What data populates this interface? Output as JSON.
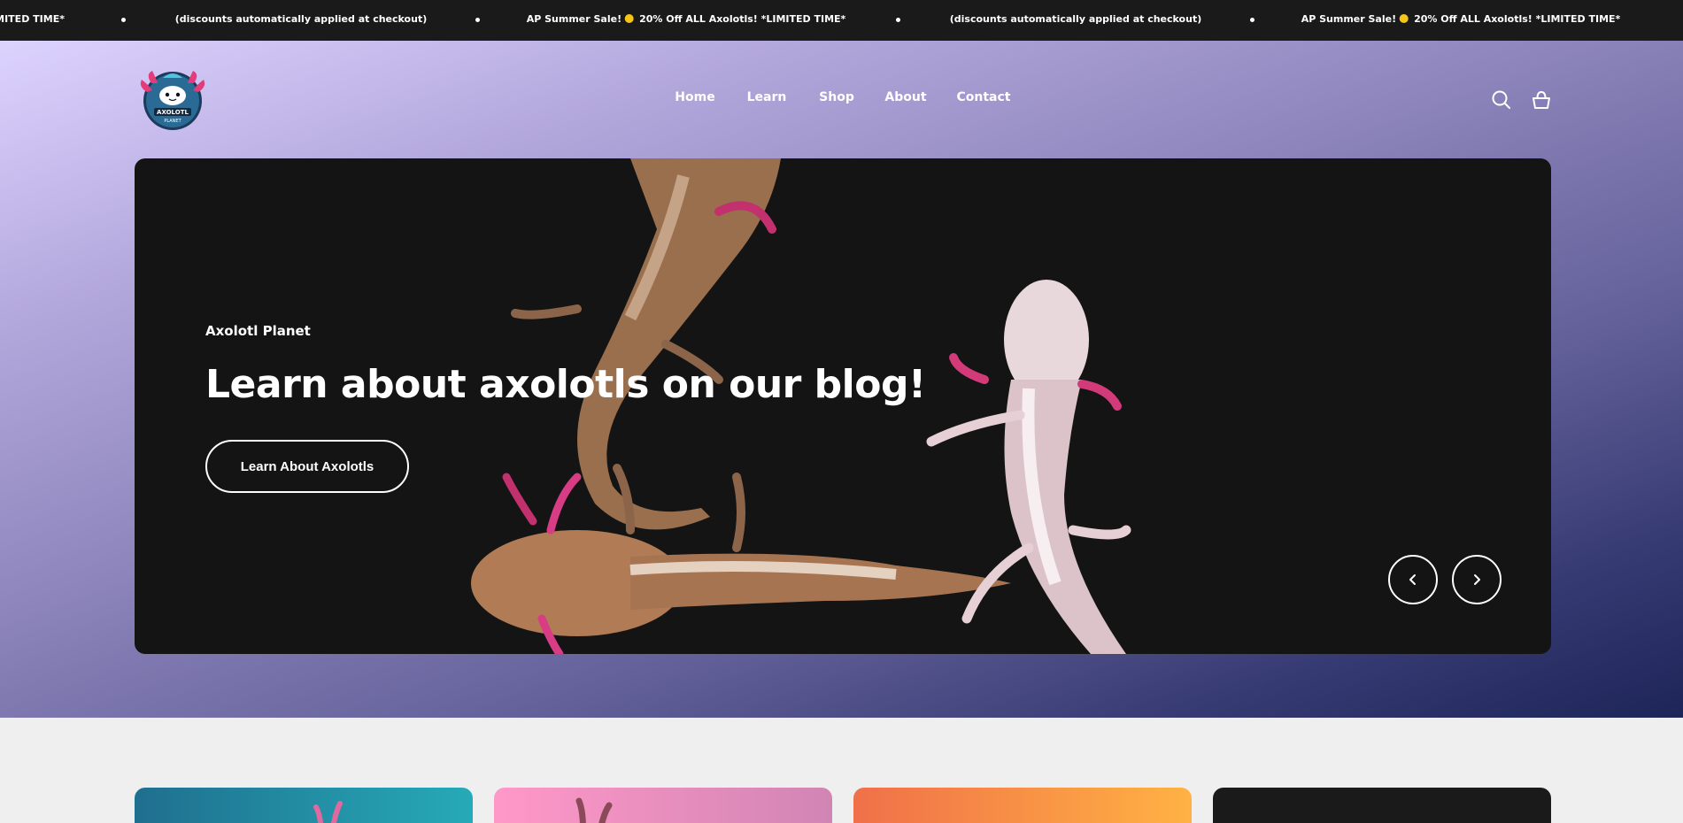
{
  "announcement": {
    "items": [
      {
        "text": "LIMITED TIME*"
      },
      {
        "text": "(discounts automatically applied at checkout)"
      },
      {
        "text_a": "AP Summer Sale!",
        "text_b": "20% Off ALL Axolotls! *LIMITED TIME*"
      },
      {
        "text": "(discounts automatically applied at checkout)"
      },
      {
        "text_a": "AP Summer Sale!",
        "text_b": "20% Off ALL Axolotls! *LIMITED TIME*"
      }
    ]
  },
  "header": {
    "logo": {
      "line1": "AXOLOTL",
      "line2": "PLANET"
    },
    "nav": [
      "Home",
      "Learn",
      "Shop",
      "About",
      "Contact"
    ],
    "icons": {
      "search": "search-icon",
      "cart": "cart-icon"
    }
  },
  "hero": {
    "kicker": "Axolotl Planet",
    "title": "Learn about axolotls on our blog!",
    "button": "Learn About Axolotls",
    "prev_icon": "chevron-left-icon",
    "next_icon": "chevron-right-icon"
  },
  "colors": {
    "announcement_bg": "#1a1a1a",
    "slide_bg": "#141414",
    "page_bg": "#efefef",
    "gradient_start": "#ddd3ff",
    "gradient_end": "#1d2558"
  }
}
